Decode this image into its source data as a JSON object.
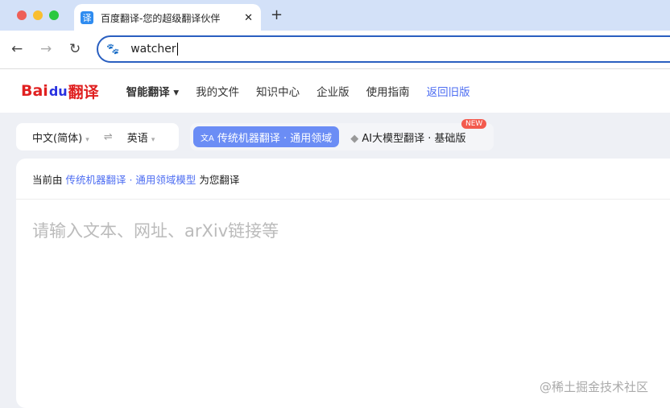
{
  "browser": {
    "tab_title": "百度翻译-您的超级翻译伙伴",
    "tab_icon": "译",
    "close": "✕",
    "new_tab": "+",
    "address": "watcher"
  },
  "header": {
    "logo": "Bai du 翻译",
    "menu": [
      "智能翻译",
      "我的文件",
      "知识中心",
      "企业版",
      "使用指南",
      "返回旧版"
    ]
  },
  "lang": {
    "source": "中文(简体)",
    "target": "英语",
    "swap": "⇌"
  },
  "modes": {
    "mode1": "传统机器翻译 · 通用领域",
    "mode2": "AI大模型翻译 · 基础版",
    "new_badge": "NEW"
  },
  "panel": {
    "prefix": "当前由",
    "model": "传统机器翻译 · 通用领域模型",
    "suffix": "为您翻译",
    "placeholder": "请输入文本、网址、arXiv链接等"
  },
  "watermark": "@稀土掘金技术社区"
}
